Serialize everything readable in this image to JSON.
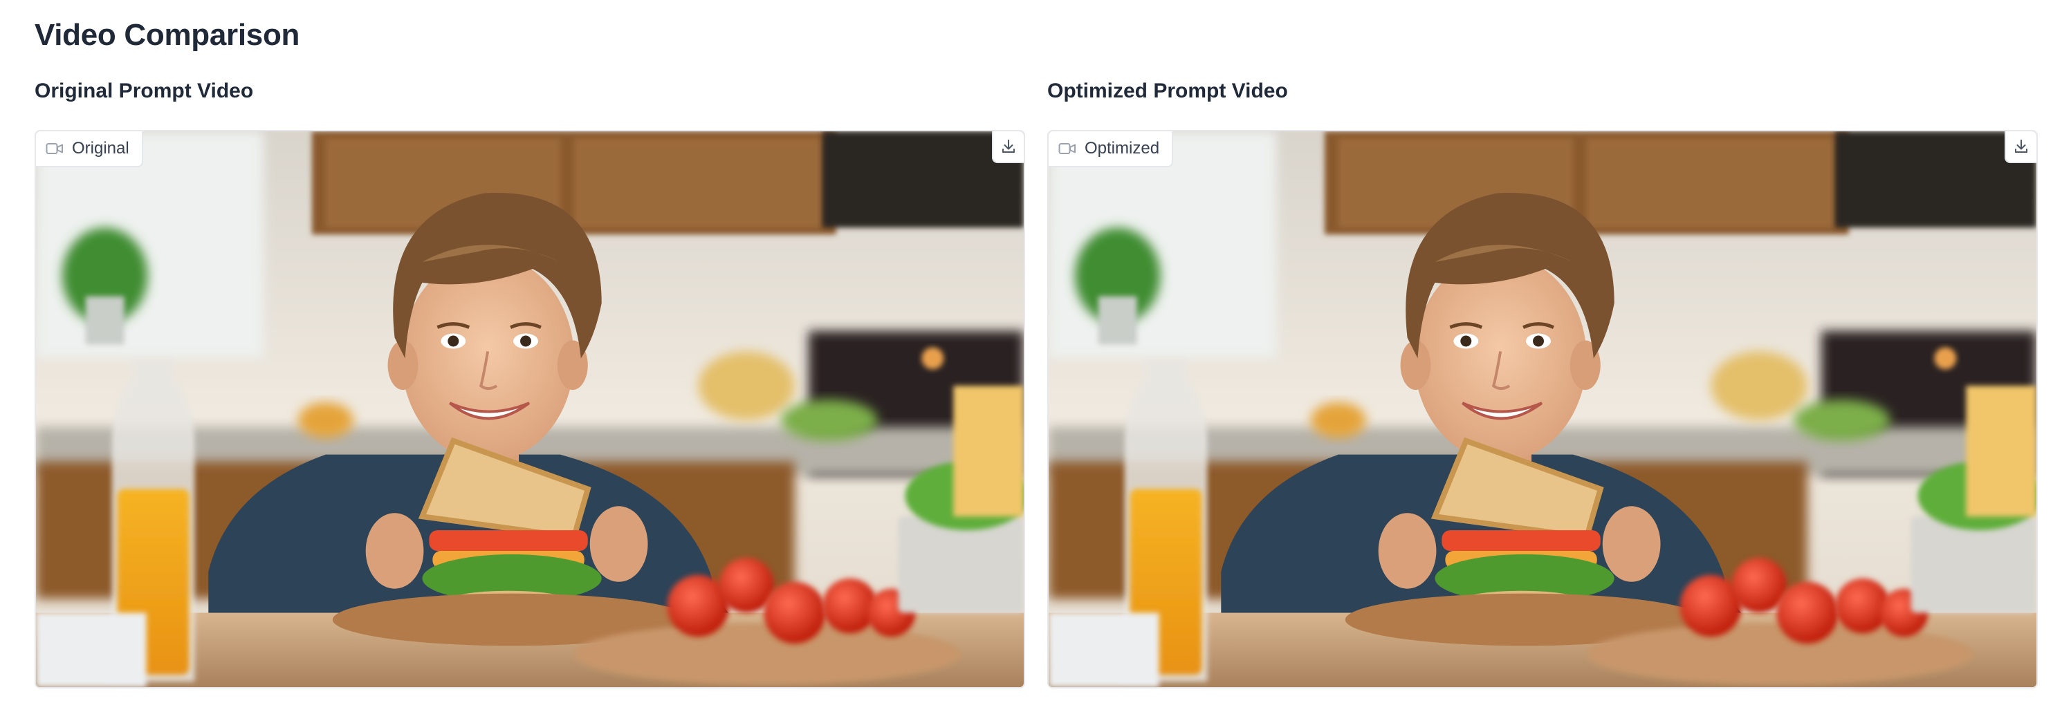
{
  "page": {
    "title": "Video Comparison"
  },
  "videos": [
    {
      "heading": "Original Prompt Video",
      "badge": "Original",
      "badge_icon": "video-camera-icon",
      "download_icon": "download-icon"
    },
    {
      "heading": "Optimized Prompt Video",
      "badge": "Optimized",
      "badge_icon": "video-camera-icon",
      "download_icon": "download-icon"
    }
  ],
  "colors": {
    "text": "#1f2937",
    "border": "#e5e7eb",
    "badge_text": "#374151"
  }
}
